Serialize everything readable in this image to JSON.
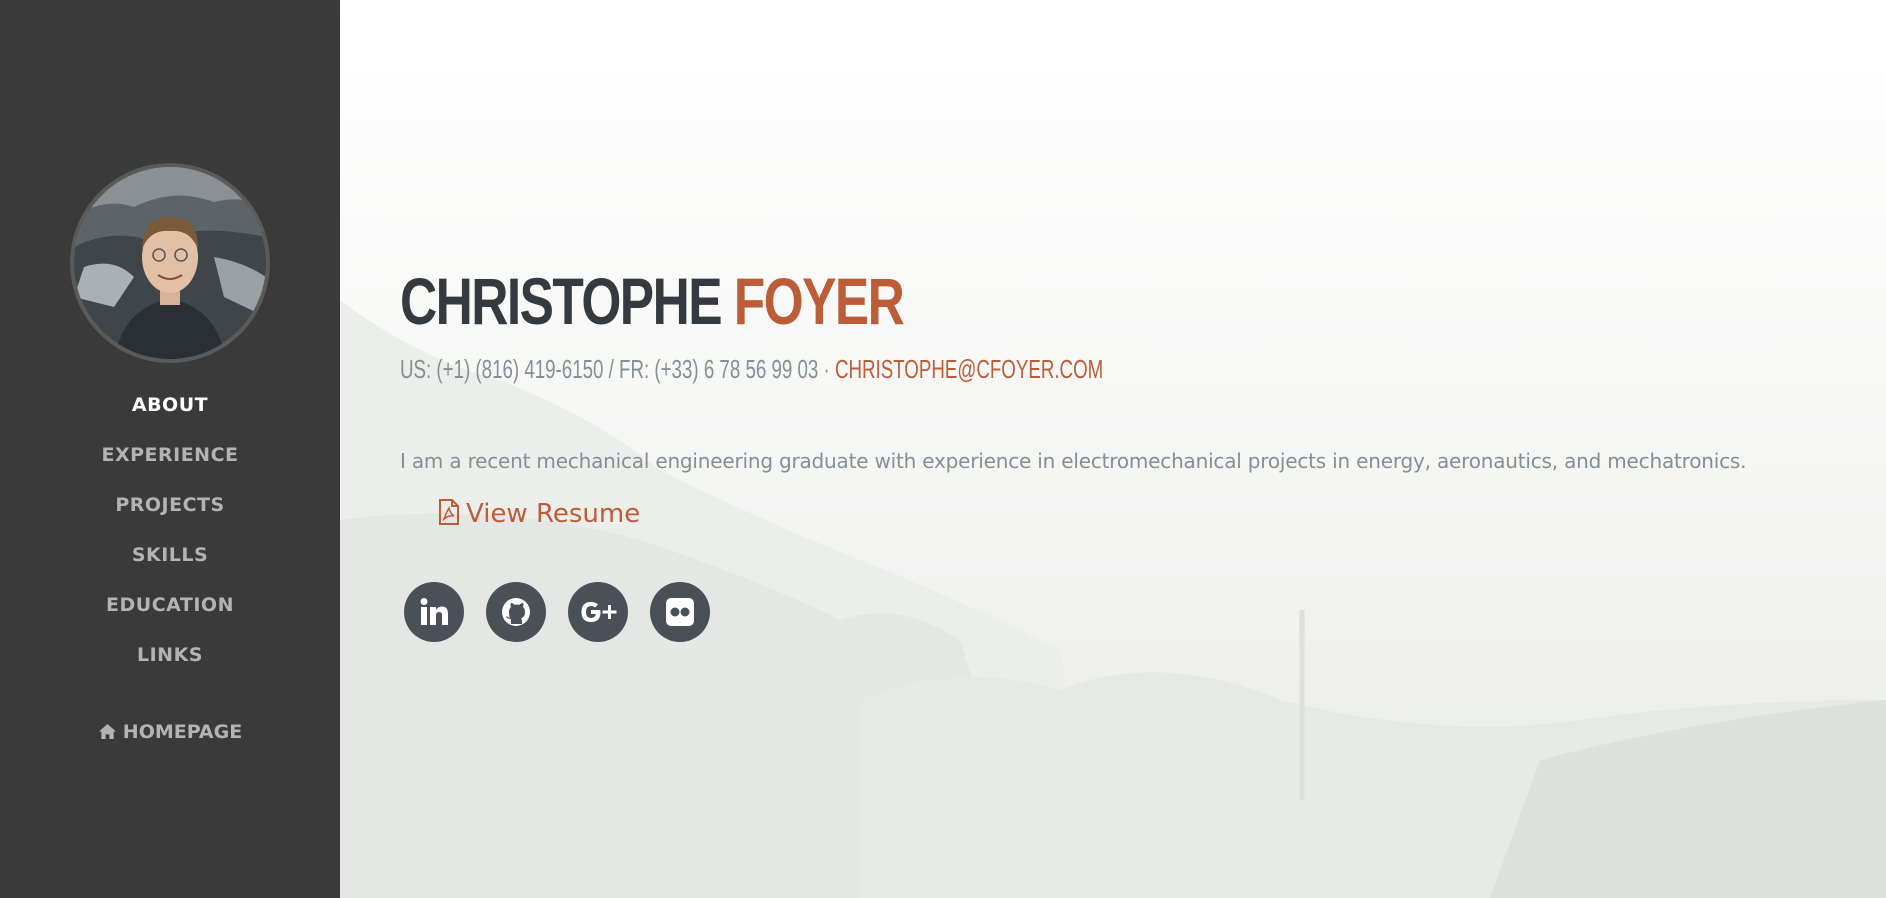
{
  "sidebar": {
    "avatar_alt": "profile photo",
    "nav": [
      {
        "label": "ABOUT",
        "active": true
      },
      {
        "label": "EXPERIENCE",
        "active": false
      },
      {
        "label": "PROJECTS",
        "active": false
      },
      {
        "label": "SKILLS",
        "active": false
      },
      {
        "label": "EDUCATION",
        "active": false
      },
      {
        "label": "LINKS",
        "active": false
      }
    ],
    "homepage_label": "HOMEPAGE",
    "homepage_icon": "home-icon"
  },
  "main": {
    "first_name": "CHRISTOPHE",
    "last_name": "FOYER",
    "phone_text": "US: (+1) (816) 419-6150 / FR: (+33) 6 78 56 99 03 · ",
    "email": "CHRISTOPHE@CFOYER.COM",
    "bio": "I am a recent mechanical engineering graduate with experience in electromechanical projects in energy, aeronautics, and mechatronics.",
    "resume_label": "View Resume",
    "resume_icon": "file-pdf-icon",
    "socials": [
      "linkedin-icon",
      "github-icon",
      "google-plus-icon",
      "flickr-icon"
    ]
  },
  "colors": {
    "sidebar_bg": "#3a3a3a",
    "accent": "#bd5d38",
    "heading": "#343a40",
    "muted": "#868e96",
    "social_bg": "#495057"
  }
}
